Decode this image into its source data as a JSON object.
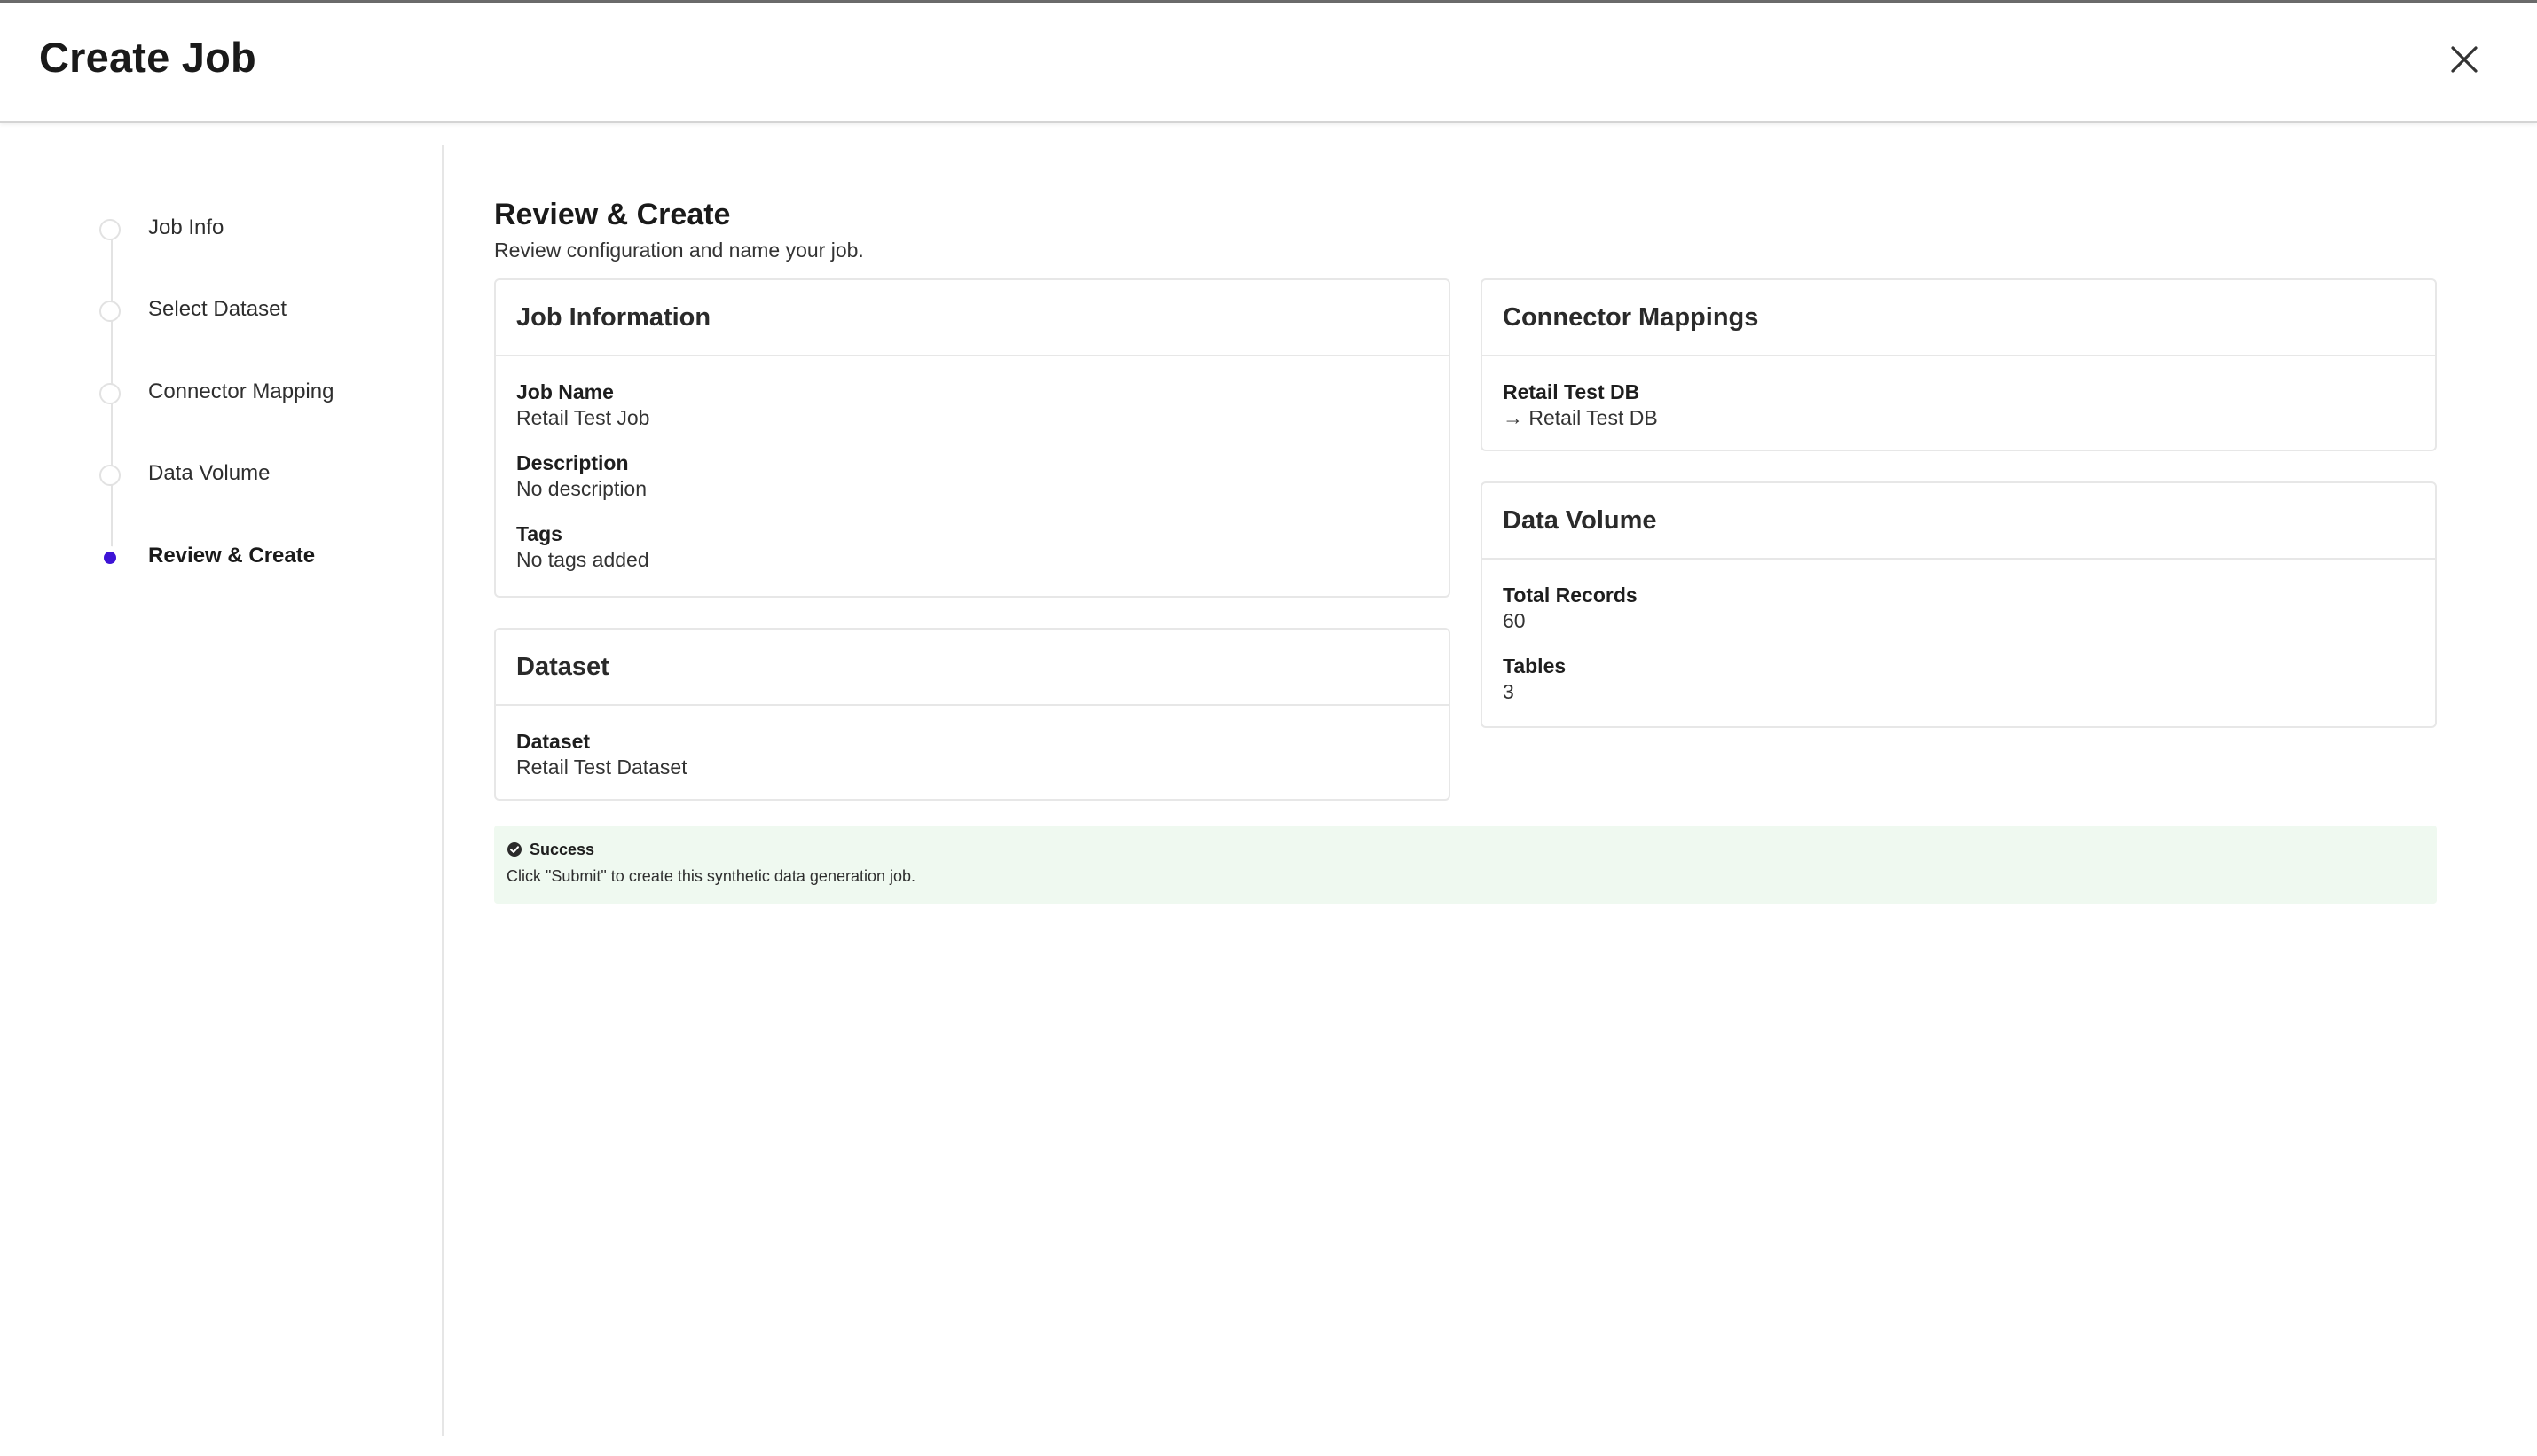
{
  "header": {
    "title": "Create Job",
    "close_icon": "close-icon"
  },
  "steps": [
    {
      "label": "Job Info",
      "state": "pending"
    },
    {
      "label": "Select Dataset",
      "state": "pending"
    },
    {
      "label": "Connector Mapping",
      "state": "pending"
    },
    {
      "label": "Data Volume",
      "state": "pending"
    },
    {
      "label": "Review & Create",
      "state": "active"
    }
  ],
  "main": {
    "title": "Review & Create",
    "subtitle": "Review configuration and name your job."
  },
  "job_information": {
    "title": "Job Information",
    "fields": [
      {
        "label": "Job Name",
        "value": "Retail Test Job"
      },
      {
        "label": "Description",
        "value": "No description"
      },
      {
        "label": "Tags",
        "value": "No tags added"
      }
    ]
  },
  "dataset": {
    "title": "Dataset",
    "fields": [
      {
        "label": "Dataset",
        "value": "Retail Test Dataset"
      }
    ]
  },
  "connector_mappings": {
    "title": "Connector Mappings",
    "fields": [
      {
        "label": "Retail Test DB",
        "value": "→ Retail Test DB"
      }
    ]
  },
  "data_volume": {
    "title": "Data Volume",
    "fields": [
      {
        "label": "Total Records",
        "value": "60"
      },
      {
        "label": "Tables",
        "value": "3"
      }
    ]
  },
  "alert": {
    "icon": "check-circle-icon",
    "title": "Success",
    "text": "Click \"Submit\" to create this synthetic data generation job.",
    "color": "#eff9f0"
  },
  "colors": {
    "accent": "#3d13d6"
  }
}
